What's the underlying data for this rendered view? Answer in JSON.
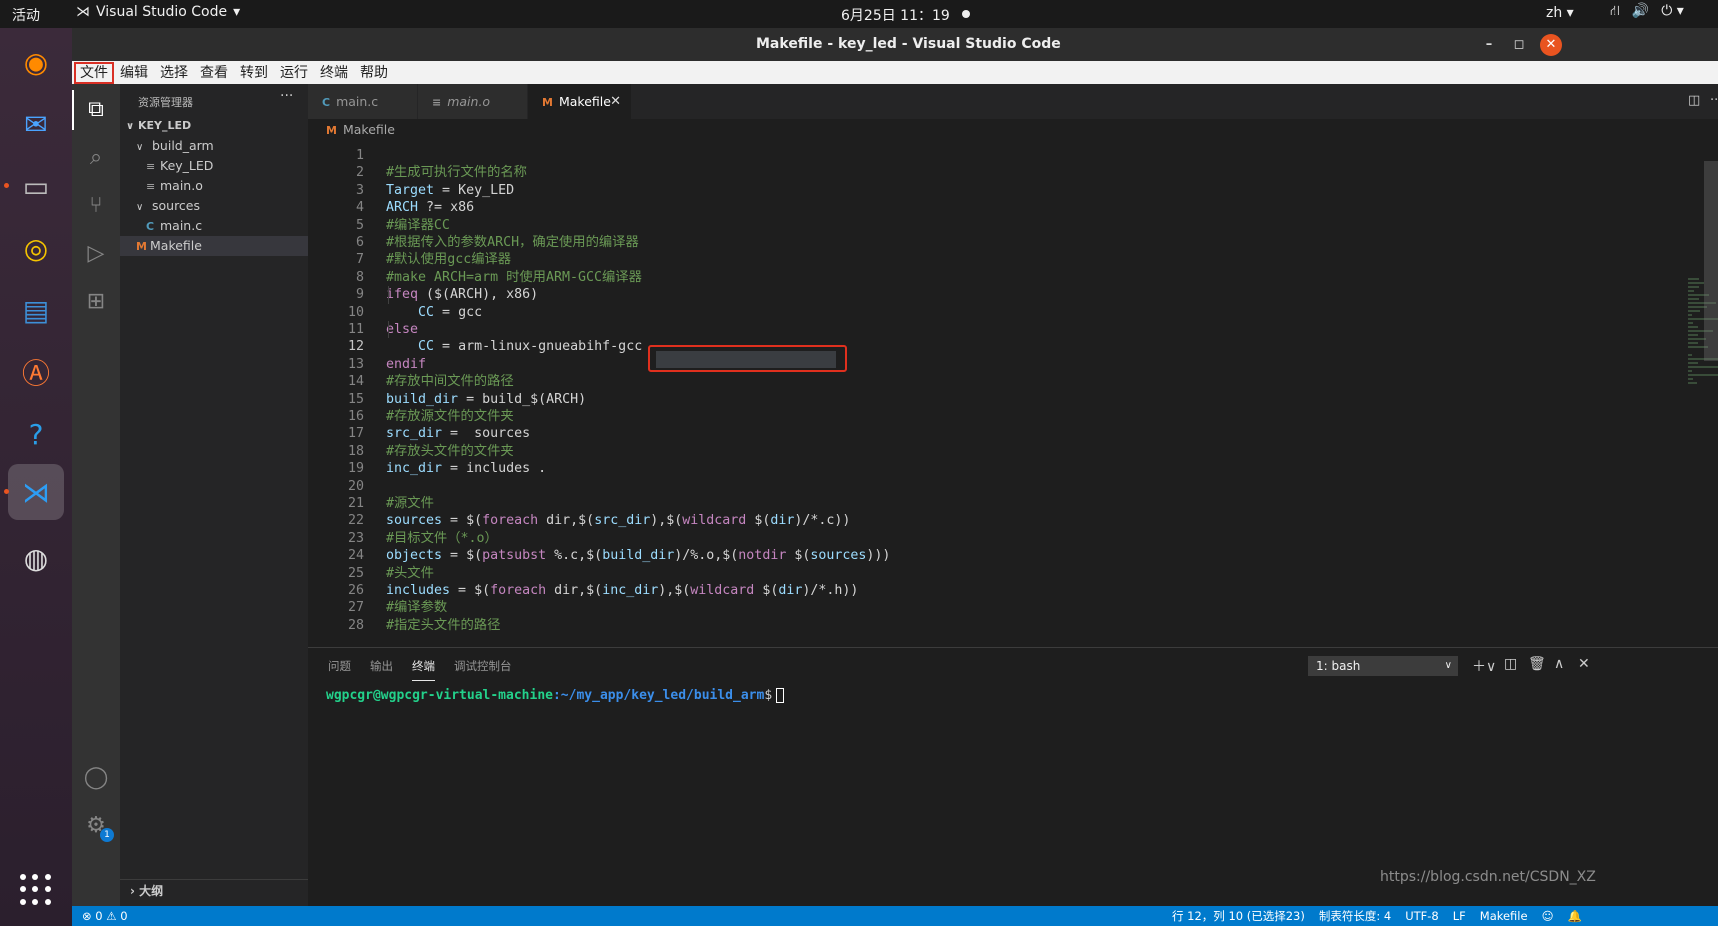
{
  "topbar": {
    "activities": "活动",
    "app_name": "Visual Studio Code",
    "clock": "6月25日  11：19",
    "lang": "zh"
  },
  "window": {
    "title": "Makefile - key_led - Visual Studio Code"
  },
  "menubar": [
    "文件",
    "编辑",
    "选择",
    "查看",
    "转到",
    "运行",
    "终端",
    "帮助"
  ],
  "sidebar": {
    "header": "资源管理器",
    "tree": [
      {
        "label": "KEY_LED",
        "type": "folder-root"
      },
      {
        "label": "build_arm",
        "type": "folder"
      },
      {
        "label": "Key_LED",
        "type": "file"
      },
      {
        "label": "main.o",
        "type": "file"
      },
      {
        "label": "sources",
        "type": "folder"
      },
      {
        "label": "main.c",
        "type": "c-file"
      },
      {
        "label": "Makefile",
        "type": "makefile"
      }
    ],
    "outline": "大纲"
  },
  "tabs": [
    {
      "label": "main.c",
      "icon": "C"
    },
    {
      "label": "main.o",
      "icon": "≡"
    },
    {
      "label": "Makefile",
      "icon": "M"
    }
  ],
  "breadcrumb": "Makefile",
  "code": {
    "current_line": 12,
    "lines": [
      "",
      "#生成可执行文件的名称",
      "Target = Key_LED",
      "ARCH ?= x86",
      "#编译器CC",
      "#根据传入的参数ARCH，确定使用的编译器",
      "#默认使用gcc编译器",
      "#make ARCH=arm 时使用ARM-GCC编译器",
      "ifeq ($(ARCH), x86)",
      "    CC = gcc",
      "else",
      "    CC = arm-linux-gnueabihf-gcc",
      "endif",
      "#存放中间文件的路径",
      "build_dir = build_$(ARCH)",
      "#存放源文件的文件夹",
      "src_dir =  sources",
      "#存放头文件的文件夹",
      "inc_dir = includes .",
      "",
      "#源文件",
      "sources = $(foreach dir,$(src_dir),$(wildcard $(dir)/*.c))",
      "#目标文件（*.o）",
      "objects = $(patsubst %.c,$(build_dir)/%.o,$(notdir $(sources)))",
      "#头文件",
      "includes = $(foreach dir,$(inc_dir),$(wildcard $(dir)/*.h))",
      "#编译参数",
      "#指定头文件的路径"
    ]
  },
  "panel": {
    "tabs": [
      "问题",
      "输出",
      "终端",
      "调试控制台"
    ],
    "active_tab": "终端",
    "terminal_select": "1: bash",
    "prompt_user": "wgpcgr@wgpcgr-virtual-machine",
    "prompt_path": ":~/my_app/key_led/build_arm",
    "prompt_symbol": "$"
  },
  "statusbar": {
    "problems": "⊗ 0 ⚠ 0",
    "position": "行 12，列 10 (已选择23)",
    "tab_size": "制表符长度: 4",
    "encoding": "UTF-8",
    "eol": "LF",
    "language": "Makefile"
  },
  "watermark": "https://blog.csdn.net/CSDN_XZ"
}
